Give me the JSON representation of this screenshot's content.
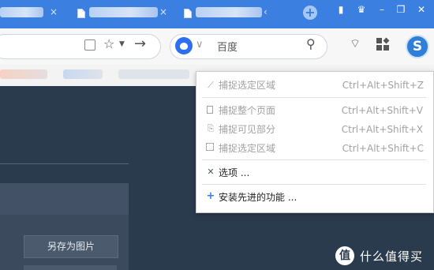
{
  "tabs": [
    {
      "label": ""
    },
    {
      "label": ""
    },
    {
      "label": ""
    }
  ],
  "toolbar": {
    "search_engine_placeholder": "百度"
  },
  "menu": {
    "items": [
      {
        "label": "捕捉选定区域",
        "shortcut": "Ctrl+Alt+Shift+Z",
        "enabled": false,
        "icon": "region-capture-icon"
      },
      {
        "label": "捕捉整个页面",
        "shortcut": "Ctrl+Alt+Shift+V",
        "enabled": false,
        "icon": "page-icon"
      },
      {
        "label": "捕捉可见部分",
        "shortcut": "Ctrl+Alt+Shift+X",
        "enabled": false,
        "icon": "visible-part-icon"
      },
      {
        "label": "捕捉选定区域",
        "shortcut": "Ctrl+Alt+Shift+C",
        "enabled": false,
        "icon": "selection-icon"
      },
      {
        "label": "选项 ...",
        "shortcut": "",
        "enabled": true,
        "icon": "tools-icon"
      },
      {
        "label": "安装先进的功能 ...",
        "shortcut": "",
        "enabled": true,
        "icon": "plus-icon"
      }
    ]
  },
  "page": {
    "save_image_label": "另存为图片"
  },
  "watermark": {
    "logo": "值",
    "text": "什么值得买"
  },
  "colors": {
    "tabbar": "#3b7fe0",
    "page_bg": "#2b3b4e",
    "extension_icon": "#2f7fd8"
  }
}
